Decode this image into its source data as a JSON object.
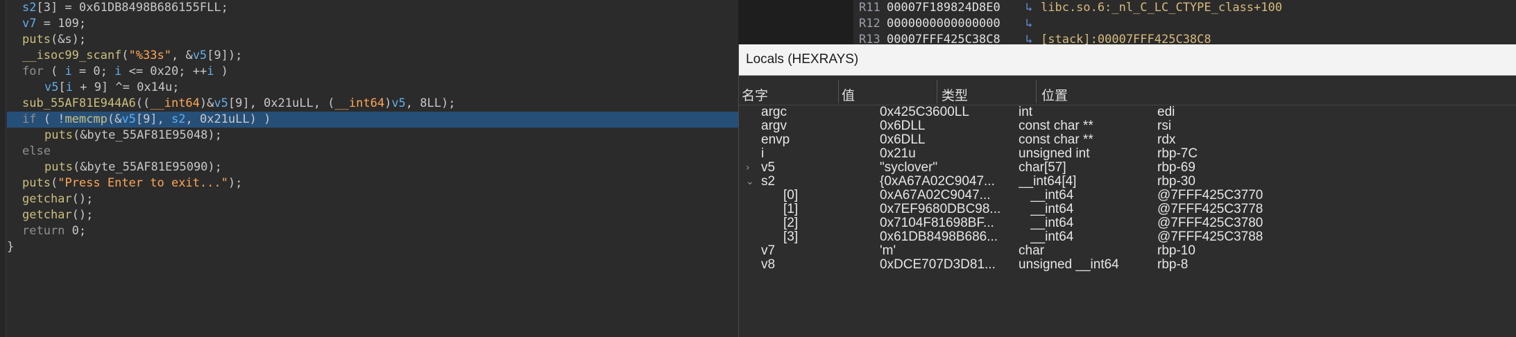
{
  "code": {
    "lines": [
      {
        "parts": [
          [
            "var",
            "s2"
          ],
          [
            "",
            "[3] = 0x61DB8498B686155FLL;"
          ]
        ],
        "indent": "1",
        "selected": false
      },
      {
        "parts": [
          [
            "var",
            "v7"
          ],
          [
            "",
            " = 109;"
          ]
        ],
        "indent": "1",
        "selected": false
      },
      {
        "parts": [
          [
            "fn",
            "puts"
          ],
          [
            "",
            "(&s);"
          ]
        ],
        "indent": "1",
        "selected": false
      },
      {
        "parts": [
          [
            "fn",
            "__isoc99_scanf"
          ],
          [
            "",
            "("
          ],
          [
            "str",
            "\"%33s\""
          ],
          [
            "",
            ", &"
          ],
          [
            "var",
            "v5"
          ],
          [
            "",
            "[9]);"
          ]
        ],
        "indent": "1",
        "selected": false
      },
      {
        "parts": [
          [
            "kw",
            "for"
          ],
          [
            "",
            " ( "
          ],
          [
            "var",
            "i"
          ],
          [
            "",
            " = 0; "
          ],
          [
            "var",
            "i"
          ],
          [
            "",
            " <= 0x20; ++"
          ],
          [
            "var",
            "i"
          ],
          [
            "",
            " )"
          ]
        ],
        "indent": "1",
        "selected": false
      },
      {
        "parts": [
          [
            "var",
            "v5"
          ],
          [
            "",
            "["
          ],
          [
            "var",
            "i"
          ],
          [
            "",
            " + 9] ^= 0x14u;"
          ]
        ],
        "indent": "2",
        "selected": false
      },
      {
        "parts": [
          [
            "fn",
            "sub_55AF81E944A6"
          ],
          [
            "",
            "(("
          ],
          [
            "str",
            "__int64"
          ],
          [
            "",
            ")&"
          ],
          [
            "var",
            "v5"
          ],
          [
            "",
            "[9], 0x21uLL, ("
          ],
          [
            "str",
            "__int64"
          ],
          [
            "",
            ")"
          ],
          [
            "var",
            "v5"
          ],
          [
            "",
            ", 8LL);"
          ]
        ],
        "indent": "1",
        "selected": false
      },
      {
        "parts": [
          [
            "kw",
            "if"
          ],
          [
            "",
            " ( !"
          ],
          [
            "fn",
            "memcmp"
          ],
          [
            "",
            "(&"
          ],
          [
            "var",
            "v5"
          ],
          [
            "",
            "[9], "
          ],
          [
            "var",
            "s2"
          ],
          [
            "",
            ", 0x21uLL) )"
          ]
        ],
        "indent": "1",
        "selected": true
      },
      {
        "parts": [
          [
            "fn",
            "puts"
          ],
          [
            "",
            "(&byte_55AF81E95048);"
          ]
        ],
        "indent": "2",
        "selected": false
      },
      {
        "parts": [
          [
            "kw",
            "else"
          ]
        ],
        "indent": "1",
        "selected": false
      },
      {
        "parts": [
          [
            "fn",
            "puts"
          ],
          [
            "",
            "(&byte_55AF81E95090);"
          ]
        ],
        "indent": "2",
        "selected": false
      },
      {
        "parts": [
          [
            "fn",
            "puts"
          ],
          [
            "",
            "("
          ],
          [
            "str",
            "\"Press Enter to exit...\""
          ],
          [
            "",
            ");"
          ]
        ],
        "indent": "1",
        "selected": false
      },
      {
        "parts": [
          [
            "fn",
            "getchar"
          ],
          [
            "",
            "();"
          ]
        ],
        "indent": "1",
        "selected": false
      },
      {
        "parts": [
          [
            "fn",
            "getchar"
          ],
          [
            "",
            "();"
          ]
        ],
        "indent": "1",
        "selected": false
      },
      {
        "parts": [
          [
            "kw",
            "return"
          ],
          [
            "",
            " 0;"
          ]
        ],
        "indent": "1",
        "selected": false
      },
      {
        "parts": [
          [
            "",
            "}"
          ]
        ],
        "indent": "0",
        "selected": false
      }
    ]
  },
  "registers": [
    {
      "name": "R11",
      "value": "00007F189824D8E0",
      "arrow": "↳",
      "symbol": "libc.so.6:_nl_C_LC_CTYPE_class+100"
    },
    {
      "name": "R12",
      "value": "0000000000000000",
      "arrow": "↳",
      "symbol": ""
    },
    {
      "name": "R13",
      "value": "00007FFF425C38C8",
      "arrow": "↳",
      "symbol": "[stack]:00007FFF425C38C8"
    }
  ],
  "locals": {
    "title": "Locals (HEXRAYS)",
    "headers": {
      "name": "名字",
      "value": "值",
      "type": "类型",
      "location": "位置"
    },
    "rows": [
      {
        "name": "argc",
        "value": "0x425C3600LL",
        "type": "int",
        "location": "edi",
        "sub": false,
        "expander": ""
      },
      {
        "name": "argv",
        "value": "0x6DLL",
        "type": "const char **",
        "location": "rsi",
        "sub": false,
        "expander": ""
      },
      {
        "name": "envp",
        "value": "0x6DLL",
        "type": "const char **",
        "location": "rdx",
        "sub": false,
        "expander": ""
      },
      {
        "name": "i",
        "value": "0x21u",
        "type": "unsigned int",
        "location": "rbp-7C",
        "sub": false,
        "expander": ""
      },
      {
        "name": "v5",
        "value": "\"syclover\"",
        "type": "char[57]",
        "location": "rbp-69",
        "sub": false,
        "expander": "›"
      },
      {
        "name": "s2",
        "value": "{0xA67A02C9047...",
        "type": "__int64[4]",
        "location": "rbp-30",
        "sub": false,
        "expander": "⌄"
      },
      {
        "name": "[0]",
        "value": "0xA67A02C9047...",
        "type": "__int64",
        "location": "@7FFF425C3770",
        "sub": true,
        "expander": ""
      },
      {
        "name": "[1]",
        "value": "0x7EF9680DBC98...",
        "type": "__int64",
        "location": "@7FFF425C3778",
        "sub": true,
        "expander": ""
      },
      {
        "name": "[2]",
        "value": "0x7104F81698BF...",
        "type": "__int64",
        "location": "@7FFF425C3780",
        "sub": true,
        "expander": ""
      },
      {
        "name": "[3]",
        "value": "0x61DB8498B686...",
        "type": "__int64",
        "location": "@7FFF425C3788",
        "sub": true,
        "expander": ""
      },
      {
        "name": "v7",
        "value": "'m'",
        "type": "char",
        "location": "rbp-10",
        "sub": false,
        "expander": ""
      },
      {
        "name": "v8",
        "value": "0xDCE707D3D81...",
        "type": "unsigned __int64",
        "location": "rbp-8",
        "sub": false,
        "expander": ""
      }
    ]
  }
}
